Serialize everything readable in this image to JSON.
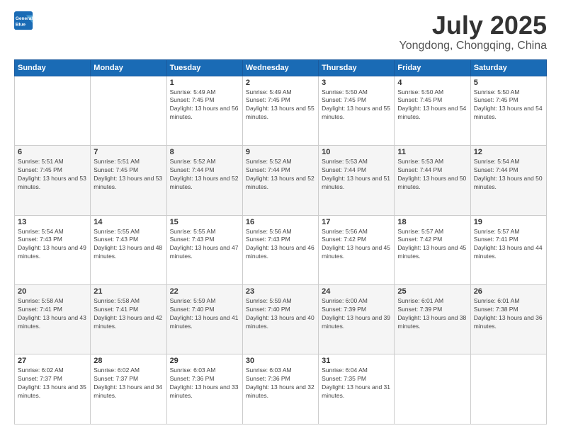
{
  "logo": {
    "line1": "General",
    "line2": "Blue"
  },
  "header": {
    "month": "July 2025",
    "location": "Yongdong, Chongqing, China"
  },
  "weekdays": [
    "Sunday",
    "Monday",
    "Tuesday",
    "Wednesday",
    "Thursday",
    "Friday",
    "Saturday"
  ],
  "weeks": [
    [
      {
        "day": "",
        "sunrise": "",
        "sunset": "",
        "daylight": ""
      },
      {
        "day": "",
        "sunrise": "",
        "sunset": "",
        "daylight": ""
      },
      {
        "day": "1",
        "sunrise": "Sunrise: 5:49 AM",
        "sunset": "Sunset: 7:45 PM",
        "daylight": "Daylight: 13 hours and 56 minutes."
      },
      {
        "day": "2",
        "sunrise": "Sunrise: 5:49 AM",
        "sunset": "Sunset: 7:45 PM",
        "daylight": "Daylight: 13 hours and 55 minutes."
      },
      {
        "day": "3",
        "sunrise": "Sunrise: 5:50 AM",
        "sunset": "Sunset: 7:45 PM",
        "daylight": "Daylight: 13 hours and 55 minutes."
      },
      {
        "day": "4",
        "sunrise": "Sunrise: 5:50 AM",
        "sunset": "Sunset: 7:45 PM",
        "daylight": "Daylight: 13 hours and 54 minutes."
      },
      {
        "day": "5",
        "sunrise": "Sunrise: 5:50 AM",
        "sunset": "Sunset: 7:45 PM",
        "daylight": "Daylight: 13 hours and 54 minutes."
      }
    ],
    [
      {
        "day": "6",
        "sunrise": "Sunrise: 5:51 AM",
        "sunset": "Sunset: 7:45 PM",
        "daylight": "Daylight: 13 hours and 53 minutes."
      },
      {
        "day": "7",
        "sunrise": "Sunrise: 5:51 AM",
        "sunset": "Sunset: 7:45 PM",
        "daylight": "Daylight: 13 hours and 53 minutes."
      },
      {
        "day": "8",
        "sunrise": "Sunrise: 5:52 AM",
        "sunset": "Sunset: 7:44 PM",
        "daylight": "Daylight: 13 hours and 52 minutes."
      },
      {
        "day": "9",
        "sunrise": "Sunrise: 5:52 AM",
        "sunset": "Sunset: 7:44 PM",
        "daylight": "Daylight: 13 hours and 52 minutes."
      },
      {
        "day": "10",
        "sunrise": "Sunrise: 5:53 AM",
        "sunset": "Sunset: 7:44 PM",
        "daylight": "Daylight: 13 hours and 51 minutes."
      },
      {
        "day": "11",
        "sunrise": "Sunrise: 5:53 AM",
        "sunset": "Sunset: 7:44 PM",
        "daylight": "Daylight: 13 hours and 50 minutes."
      },
      {
        "day": "12",
        "sunrise": "Sunrise: 5:54 AM",
        "sunset": "Sunset: 7:44 PM",
        "daylight": "Daylight: 13 hours and 50 minutes."
      }
    ],
    [
      {
        "day": "13",
        "sunrise": "Sunrise: 5:54 AM",
        "sunset": "Sunset: 7:43 PM",
        "daylight": "Daylight: 13 hours and 49 minutes."
      },
      {
        "day": "14",
        "sunrise": "Sunrise: 5:55 AM",
        "sunset": "Sunset: 7:43 PM",
        "daylight": "Daylight: 13 hours and 48 minutes."
      },
      {
        "day": "15",
        "sunrise": "Sunrise: 5:55 AM",
        "sunset": "Sunset: 7:43 PM",
        "daylight": "Daylight: 13 hours and 47 minutes."
      },
      {
        "day": "16",
        "sunrise": "Sunrise: 5:56 AM",
        "sunset": "Sunset: 7:43 PM",
        "daylight": "Daylight: 13 hours and 46 minutes."
      },
      {
        "day": "17",
        "sunrise": "Sunrise: 5:56 AM",
        "sunset": "Sunset: 7:42 PM",
        "daylight": "Daylight: 13 hours and 45 minutes."
      },
      {
        "day": "18",
        "sunrise": "Sunrise: 5:57 AM",
        "sunset": "Sunset: 7:42 PM",
        "daylight": "Daylight: 13 hours and 45 minutes."
      },
      {
        "day": "19",
        "sunrise": "Sunrise: 5:57 AM",
        "sunset": "Sunset: 7:41 PM",
        "daylight": "Daylight: 13 hours and 44 minutes."
      }
    ],
    [
      {
        "day": "20",
        "sunrise": "Sunrise: 5:58 AM",
        "sunset": "Sunset: 7:41 PM",
        "daylight": "Daylight: 13 hours and 43 minutes."
      },
      {
        "day": "21",
        "sunrise": "Sunrise: 5:58 AM",
        "sunset": "Sunset: 7:41 PM",
        "daylight": "Daylight: 13 hours and 42 minutes."
      },
      {
        "day": "22",
        "sunrise": "Sunrise: 5:59 AM",
        "sunset": "Sunset: 7:40 PM",
        "daylight": "Daylight: 13 hours and 41 minutes."
      },
      {
        "day": "23",
        "sunrise": "Sunrise: 5:59 AM",
        "sunset": "Sunset: 7:40 PM",
        "daylight": "Daylight: 13 hours and 40 minutes."
      },
      {
        "day": "24",
        "sunrise": "Sunrise: 6:00 AM",
        "sunset": "Sunset: 7:39 PM",
        "daylight": "Daylight: 13 hours and 39 minutes."
      },
      {
        "day": "25",
        "sunrise": "Sunrise: 6:01 AM",
        "sunset": "Sunset: 7:39 PM",
        "daylight": "Daylight: 13 hours and 38 minutes."
      },
      {
        "day": "26",
        "sunrise": "Sunrise: 6:01 AM",
        "sunset": "Sunset: 7:38 PM",
        "daylight": "Daylight: 13 hours and 36 minutes."
      }
    ],
    [
      {
        "day": "27",
        "sunrise": "Sunrise: 6:02 AM",
        "sunset": "Sunset: 7:37 PM",
        "daylight": "Daylight: 13 hours and 35 minutes."
      },
      {
        "day": "28",
        "sunrise": "Sunrise: 6:02 AM",
        "sunset": "Sunset: 7:37 PM",
        "daylight": "Daylight: 13 hours and 34 minutes."
      },
      {
        "day": "29",
        "sunrise": "Sunrise: 6:03 AM",
        "sunset": "Sunset: 7:36 PM",
        "daylight": "Daylight: 13 hours and 33 minutes."
      },
      {
        "day": "30",
        "sunrise": "Sunrise: 6:03 AM",
        "sunset": "Sunset: 7:36 PM",
        "daylight": "Daylight: 13 hours and 32 minutes."
      },
      {
        "day": "31",
        "sunrise": "Sunrise: 6:04 AM",
        "sunset": "Sunset: 7:35 PM",
        "daylight": "Daylight: 13 hours and 31 minutes."
      },
      {
        "day": "",
        "sunrise": "",
        "sunset": "",
        "daylight": ""
      },
      {
        "day": "",
        "sunrise": "",
        "sunset": "",
        "daylight": ""
      }
    ]
  ]
}
